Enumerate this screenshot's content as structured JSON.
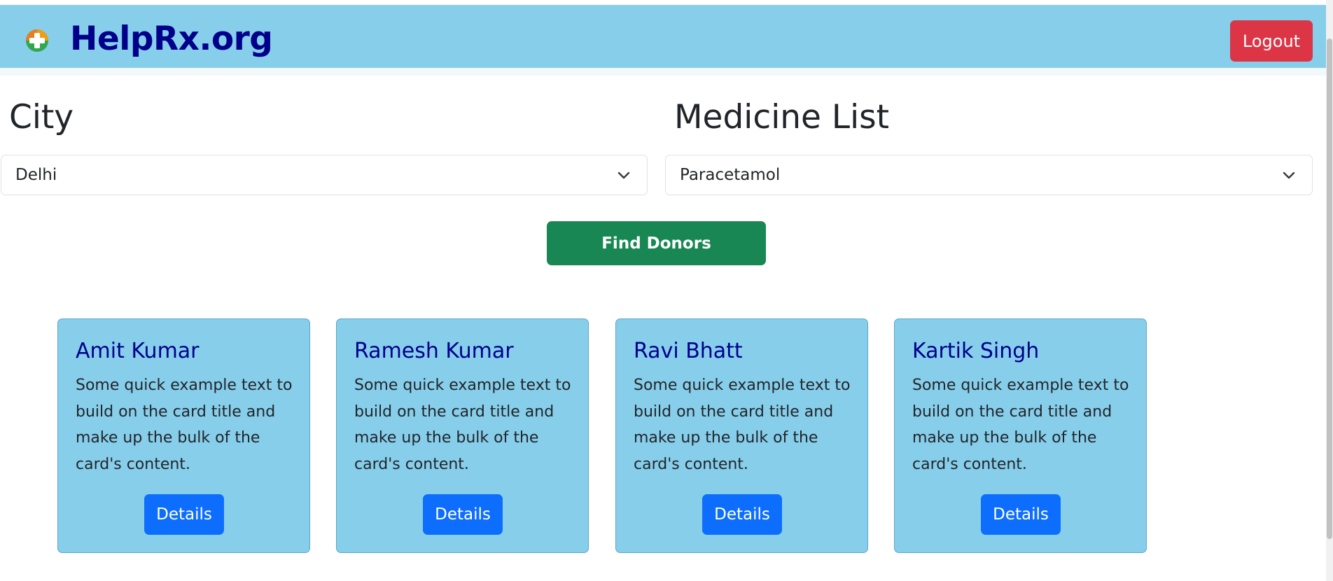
{
  "header": {
    "brand": "HelpRx.org",
    "logout_label": "Logout",
    "colors": {
      "bar": "#87ceeb",
      "brand_text": "#00008b",
      "logout": "#dc3545"
    }
  },
  "filters": {
    "city": {
      "title": "City",
      "selected": "Delhi"
    },
    "medicine": {
      "title": "Medicine List",
      "selected": "Paracetamol"
    },
    "find_label": "Find Donors",
    "find_color": "#198754"
  },
  "donors": [
    {
      "name": "Amit Kumar",
      "text": "Some quick example text to build on the card title and make up the bulk of the card's content.",
      "button": "Details"
    },
    {
      "name": "Ramesh Kumar",
      "text": "Some quick example text to build on the card title and make up the bulk of the card's content.",
      "button": "Details"
    },
    {
      "name": "Ravi Bhatt",
      "text": "Some quick example text to build on the card title and make up the bulk of the card's content.",
      "button": "Details"
    },
    {
      "name": "Kartik Singh",
      "text": "Some quick example text to build on the card title and make up the bulk of the card's content.",
      "button": "Details"
    }
  ],
  "icons": {
    "brand": "medical-cross-icon",
    "select_arrow": "chevron-down-icon"
  }
}
